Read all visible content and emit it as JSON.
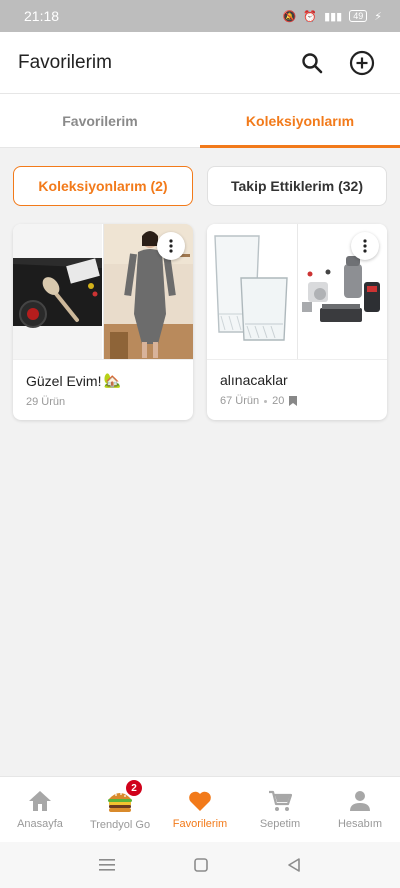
{
  "status_bar": {
    "time": "21:18",
    "battery": "49"
  },
  "header": {
    "title": "Favorilerim",
    "search_icon": "search-icon",
    "add_icon": "add-circle-icon"
  },
  "tabs": [
    {
      "label": "Favorilerim",
      "active": false
    },
    {
      "label": "Koleksiyonlarım",
      "active": true
    }
  ],
  "chips": [
    {
      "label": "Koleksiyonlarım (2)",
      "active": true
    },
    {
      "label": "Takip Ettiklerim (32)",
      "active": false
    }
  ],
  "collections": [
    {
      "title": "Güzel Evim!",
      "emoji": "🏡",
      "products": "29 Ürün"
    },
    {
      "title": "alınacaklar",
      "products": "67 Ürün",
      "followers": "20"
    }
  ],
  "bottom_nav": [
    {
      "label": "Anasayfa",
      "icon": "home-icon"
    },
    {
      "label": "Trendyol Go",
      "icon": "burger-icon",
      "badge": "2"
    },
    {
      "label": "Favorilerim",
      "icon": "heart-icon",
      "active": true
    },
    {
      "label": "Sepetim",
      "icon": "cart-icon"
    },
    {
      "label": "Hesabım",
      "icon": "user-icon"
    }
  ],
  "colors": {
    "accent": "#f27a1a",
    "badge": "#d0021b"
  }
}
